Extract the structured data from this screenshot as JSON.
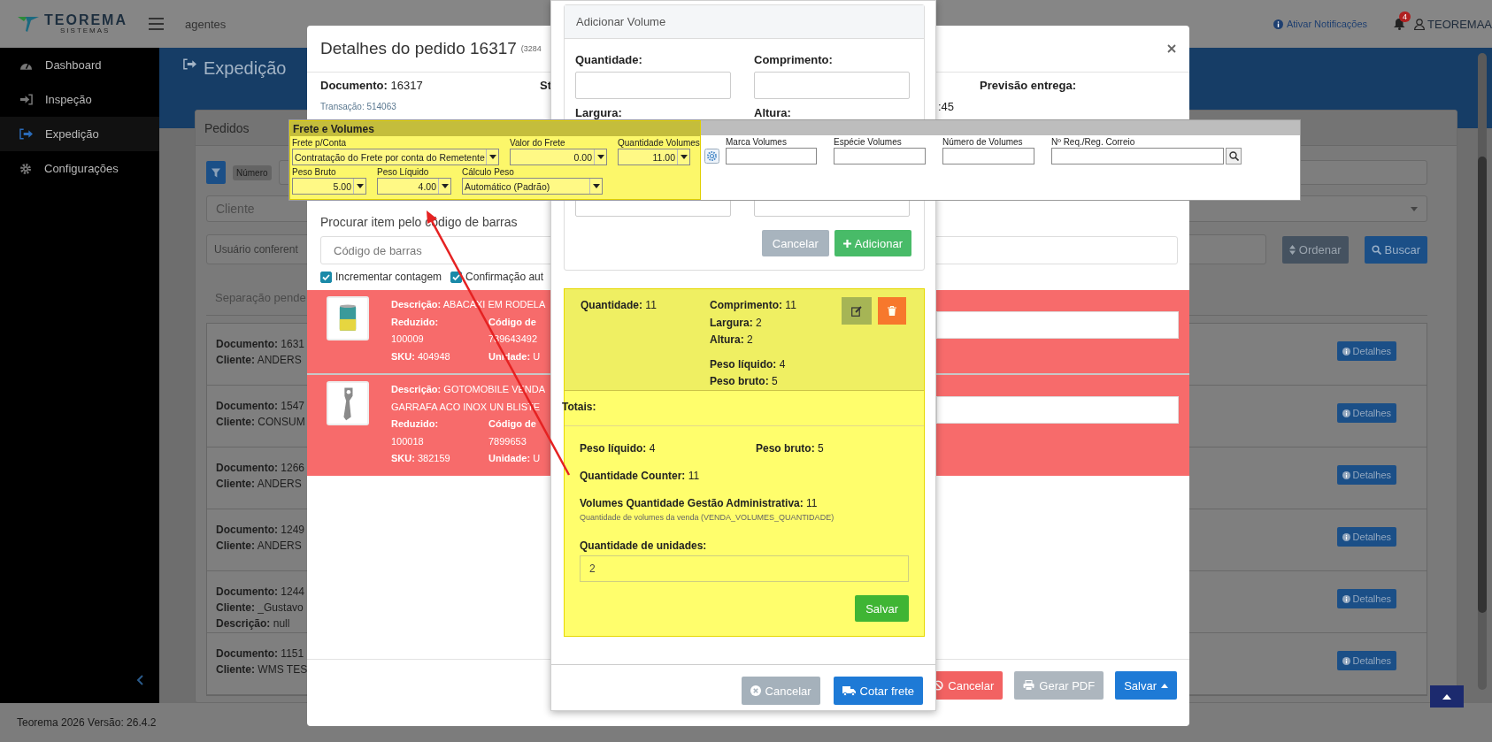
{
  "app_header": {
    "brand": "TEOREMA",
    "brand_tagline": "SISTEMAS",
    "context": "agentes",
    "notifications_link": "Ativar Notificações",
    "notification_count": "4",
    "user": "TEOREMAA"
  },
  "sidebar": {
    "items": [
      {
        "label": "Dashboard",
        "kind": "gauge",
        "selected": false
      },
      {
        "label": "Inspeção",
        "kind": "sign-in",
        "selected": false
      },
      {
        "label": "Expedição",
        "kind": "sign-out",
        "selected": true
      },
      {
        "label": "Configurações",
        "kind": "gear",
        "selected": false
      }
    ]
  },
  "page": {
    "title": "Expedição"
  },
  "orders_panel": {
    "tab": "Pedidos",
    "filter_chip": "Número",
    "client_placeholder": "Cliente",
    "checker_placeholder": "Usuário conferent",
    "sort_button": "Ordenar",
    "search_button": "Buscar",
    "list_tab": "Separação pende",
    "orders": [
      {
        "lines": [
          {
            "label": "Documento:",
            "value": "1631"
          },
          {
            "label": "Cliente:",
            "value": "ANDERS"
          }
        ],
        "details_button": "Detalhes"
      },
      {
        "lines": [
          {
            "label": "Documento:",
            "value": "1547"
          },
          {
            "label": "Cliente:",
            "value": "CONSUM"
          }
        ],
        "details_button": "Detalhes"
      },
      {
        "lines": [
          {
            "label": "Documento:",
            "value": "1266"
          },
          {
            "label": "Cliente:",
            "value": "ANDERS"
          }
        ],
        "details_button": "Detalhes"
      },
      {
        "lines": [
          {
            "label": "Documento:",
            "value": "1249"
          },
          {
            "label": "Cliente:",
            "value": "ANDERS"
          }
        ],
        "details_button": "Detalhes"
      },
      {
        "lines": [
          {
            "label": "Documento:",
            "value": "1244"
          },
          {
            "label": "Cliente:",
            "value": "_Gustavo"
          },
          {
            "label": "Descrição:",
            "value": "null"
          }
        ],
        "details_button": "Detalhes"
      },
      {
        "lines": [
          {
            "label": "Documento:",
            "value": "1151"
          },
          {
            "label": "Cliente:",
            "value": "WMS TES"
          }
        ],
        "details_button": "Detalhes"
      }
    ]
  },
  "footer": {
    "version": "Teorema 2026 Versão: 26.4.2"
  },
  "order_modal": {
    "title": "Detalhes do pedido 16317",
    "subtitle": "(3284",
    "document": {
      "label": "Documento:",
      "value": "16317"
    },
    "transaction": "Transação: 514063",
    "status_label": "St",
    "delivery_label": "Previsão entrega:",
    "delivery_value": ":45",
    "barcode_label": "Procurar item pelo código de barras",
    "barcode_placeholder": "Código de barras",
    "options": [
      {
        "label": "Incrementar contagem",
        "checked": true
      },
      {
        "label": "Confirmação aut",
        "checked": true
      }
    ],
    "items": [
      {
        "kind": "can",
        "description": [
          {
            "label": "Descrição:",
            "value": "ABACAXI EM RODELA"
          }
        ],
        "col1": [
          {
            "label": "Reduzido:"
          },
          {
            "value": "100009"
          },
          {
            "label": "SKU:",
            "value": "404948"
          }
        ],
        "col2": [
          {
            "label": "Código de"
          },
          {
            "value": "789643492"
          },
          {
            "label": "Unidade:",
            "value": "U"
          }
        ]
      },
      {
        "kind": "opener",
        "description": [
          {
            "label": "Descrição:",
            "value": "GOTOMOBILE VENDA"
          },
          {
            "value": "GARRAFA ACO INOX UN BLISTE"
          }
        ],
        "col1": [
          {
            "label": "Reduzido:"
          },
          {
            "value": "100018"
          },
          {
            "label": "SKU:",
            "value": "382159"
          }
        ],
        "col2": [
          {
            "label": "Código de"
          },
          {
            "value": "7899653"
          },
          {
            "label": "Unidade:",
            "value": "U"
          }
        ]
      }
    ],
    "footer_buttons": [
      {
        "label": "Cancelar",
        "kind": "danger"
      },
      {
        "label": "Gerar PDF",
        "kind": "print"
      },
      {
        "label": "Salvar",
        "kind": "dropdown"
      }
    ]
  },
  "volume_modal": {
    "title": "Adicionar Volume",
    "labels": [
      "Quantidade:",
      "Comprimento:",
      "Largura:",
      "Altura:"
    ],
    "cancel_button": "Cancelar",
    "add_button": "Adicionar",
    "volumes": [
      {
        "quantity": {
          "label": "Quantidade:",
          "value": "11"
        },
        "details": [
          {
            "label": "Comprimento:",
            "value": "11"
          },
          {
            "label": "Largura:",
            "value": "2"
          },
          {
            "label": "Altura:",
            "value": "2"
          },
          {
            "label": "Peso líquido:",
            "value": "4"
          },
          {
            "label": "Peso bruto:",
            "value": "5"
          }
        ]
      }
    ],
    "totals_label": "Totais:",
    "totals": {
      "net_weight": {
        "label": "Peso líquido:",
        "value": "4"
      },
      "gross_weight": {
        "label": "Peso bruto:",
        "value": "5"
      },
      "counter": {
        "label": "Quantidade Counter:",
        "value": "11"
      },
      "admin_volumes": {
        "label": "Volumes Quantidade Gestão Administrativa:",
        "value": "11"
      },
      "admin_hint": "Quantidade de volumes da venda (VENDA_VOLUMES_QUANTIDADE)",
      "units_label": "Quantidade de unidades:",
      "units_value": "2",
      "save_button": "Salvar"
    },
    "footer_buttons": [
      {
        "label": "Cancelar",
        "kind": "secondary"
      },
      {
        "label": "Cotar frete",
        "kind": "truck"
      }
    ]
  },
  "freight_panel": {
    "title": "Frete e Volumes",
    "highlighted_rows": [
      [
        {
          "label": "Frete p/Conta",
          "value": "Contratação do Frete por conta do Remetente",
          "kind": "select"
        },
        {
          "label": "Valor do Frete",
          "value": "0.00",
          "kind": "number"
        },
        {
          "label": "Quantidade Volumes",
          "value": "11.00",
          "kind": "number"
        }
      ],
      [
        {
          "label": "Peso Bruto",
          "value": "5.00",
          "kind": "number"
        },
        {
          "label": "Peso Líquido",
          "value": "4.00",
          "kind": "number"
        },
        {
          "label": "Cálculo Peso",
          "value": "Automático (Padrão)",
          "kind": "select"
        }
      ]
    ],
    "fields": [
      {
        "label": "Marca Volumes",
        "kind": "text"
      },
      {
        "label": "Espécie Volumes",
        "kind": "text"
      },
      {
        "label": "Número de Volumes",
        "kind": "text"
      },
      {
        "label": "Nº Req./Reg. Correio",
        "kind": "lookup"
      }
    ]
  }
}
